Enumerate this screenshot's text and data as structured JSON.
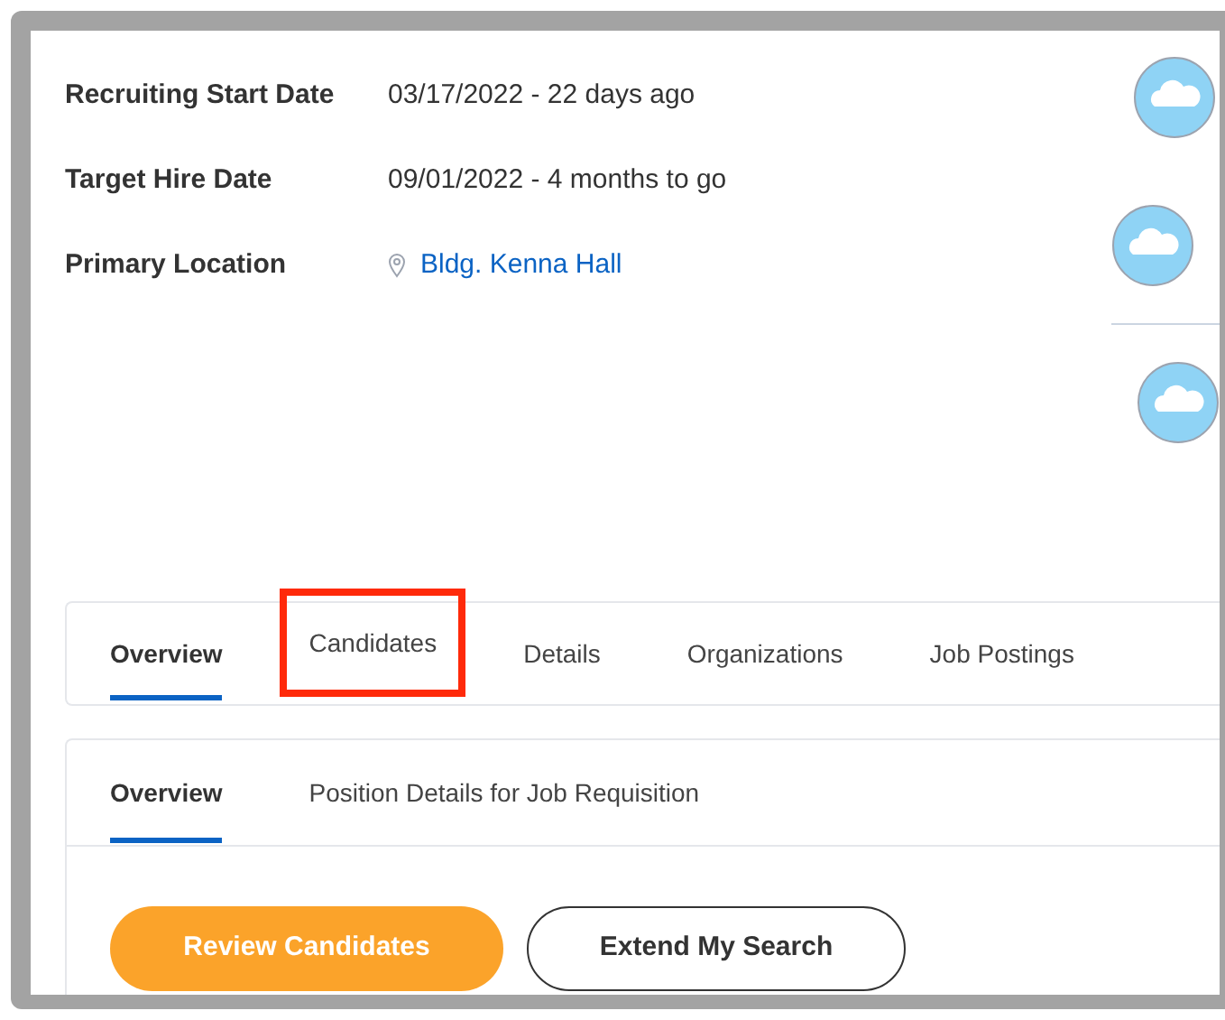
{
  "fields": [
    {
      "label": "Recruiting Start Date",
      "value": "03/17/2022 - 22 days ago",
      "kind": "text"
    },
    {
      "label": "Target Hire Date",
      "value": "09/01/2022 - 4 months to go",
      "kind": "text"
    },
    {
      "label": "Primary Location",
      "value": "Bldg. Kenna Hall",
      "kind": "location"
    }
  ],
  "avatars": [
    {
      "kind": "avatar"
    },
    {
      "kind": "avatar"
    },
    {
      "kind": "avatar"
    }
  ],
  "tabs": [
    {
      "label": "Overview",
      "selected": true,
      "highlighted": false
    },
    {
      "label": "Candidates",
      "selected": false,
      "highlighted": true
    },
    {
      "label": "Details",
      "selected": false,
      "highlighted": false
    },
    {
      "label": "Organizations",
      "selected": false,
      "highlighted": false
    },
    {
      "label": "Job Postings",
      "selected": false,
      "highlighted": false
    }
  ],
  "subtabs": [
    {
      "label": "Overview",
      "selected": true
    },
    {
      "label": "Position Details for Job Requisition",
      "selected": false
    }
  ],
  "buttons": [
    {
      "label": "Review Candidates",
      "kind": "primary"
    },
    {
      "label": "Extend My Search",
      "kind": "secondary"
    }
  ]
}
